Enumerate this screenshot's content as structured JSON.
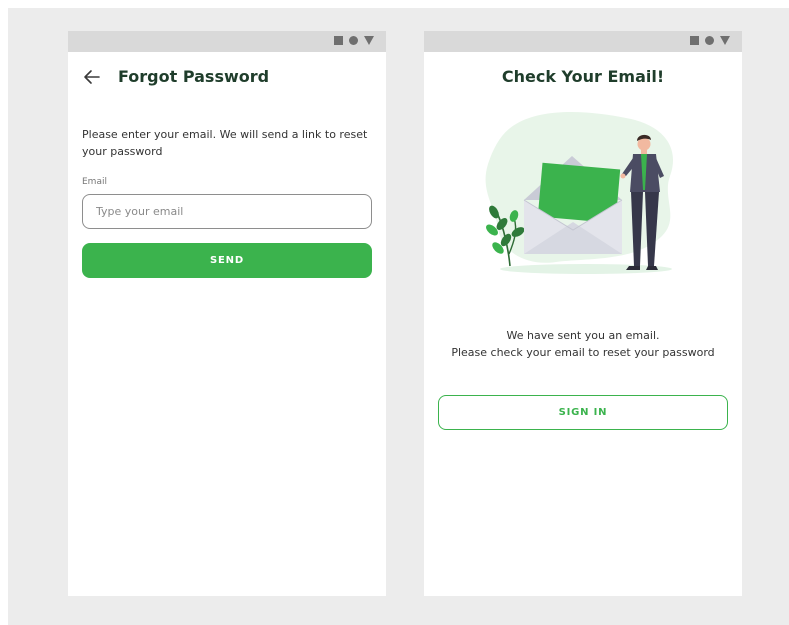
{
  "forgot_screen": {
    "title": "Forgot Password",
    "instructions": "Please enter your email. We will send a link to reset your password",
    "email_label": "Email",
    "email_placeholder": "Type your email",
    "email_value": "",
    "send_label": "SEND",
    "back_icon": "arrow-left-icon"
  },
  "check_screen": {
    "title": "Check Your Email!",
    "message": "We have sent you an email.\nPlease check your email to reset your password",
    "signin_label": "SIGN IN",
    "illustration": "envelope-man-illustration"
  },
  "status_bar": {
    "icons": [
      "square-icon",
      "circle-icon",
      "triangle-icon"
    ]
  },
  "colors": {
    "accent": "#3bb34d",
    "title": "#1f3d2b",
    "statusbar": "#d9d9d9",
    "background": "#ececec"
  }
}
